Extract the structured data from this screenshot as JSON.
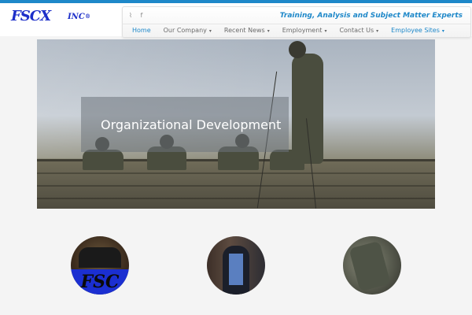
{
  "brand": {
    "logo_text": "FSCX",
    "logo_suffix": "INC",
    "logo_mark": "®"
  },
  "header": {
    "social": [
      {
        "icon": "rss-icon",
        "glyph": "⌇"
      },
      {
        "icon": "facebook-icon",
        "glyph": "f"
      }
    ],
    "tagline": "Training, Analysis and Subject Matter Experts"
  },
  "nav": {
    "items": [
      {
        "label": "Home",
        "dropdown": false
      },
      {
        "label": "Our Company",
        "dropdown": true
      },
      {
        "label": "Recent News",
        "dropdown": true
      },
      {
        "label": "Employment",
        "dropdown": true
      },
      {
        "label": "Contact Us",
        "dropdown": true
      },
      {
        "label": "Employee Sites",
        "dropdown": true
      }
    ],
    "caret": "▾"
  },
  "hero": {
    "caption": "Organizational Development"
  },
  "features": {
    "logo_text": "FSC"
  },
  "colors": {
    "accent": "#1e88c9",
    "brand": "#1d2fc9"
  }
}
